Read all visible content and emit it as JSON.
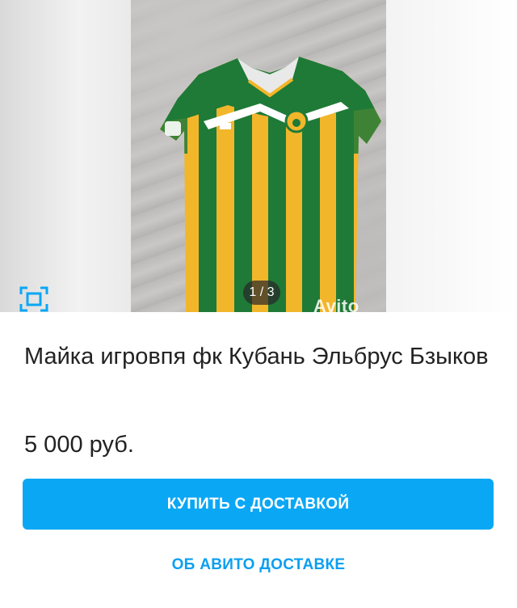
{
  "gallery": {
    "counter": "1 / 3",
    "watermark": "Avito",
    "fullscreen_icon": "fullscreen-icon",
    "image_subject": "football-jersey-icon",
    "colors": {
      "stripe_green": "#1f7a37",
      "stripe_yellow": "#f2b62b"
    }
  },
  "listing": {
    "title": "Майка игровпя фк Кубань Эльбрус Бзыков",
    "price": "5 000 руб."
  },
  "actions": {
    "buy_label": "КУПИТЬ С ДОСТАВКОЙ",
    "about_label": "ОБ АВИТО ДОСТАВКЕ"
  },
  "colors": {
    "accent": "#0aa7f5",
    "link": "#0a9ff0",
    "text": "#222222"
  }
}
